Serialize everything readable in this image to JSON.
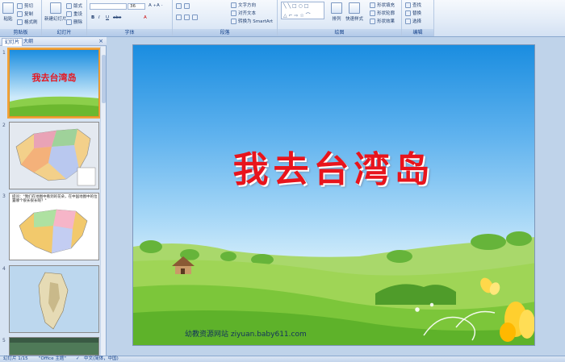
{
  "ribbon": {
    "clipboard": {
      "paste": "粘贴",
      "cut": "剪切",
      "copy": "复制",
      "format_painter": "格式刷",
      "label": "剪贴板"
    },
    "slides": {
      "new_slide": "新建幻灯片",
      "layout": "版式",
      "reset": "重设",
      "delete": "删除",
      "label": "幻灯片"
    },
    "font": {
      "font_size": "36",
      "label": "字体"
    },
    "paragraph": {
      "text_direction": "文字方向",
      "align_text": "对齐文本",
      "convert_smartart": "转换为 SmartArt",
      "label": "段落"
    },
    "drawing": {
      "arrange": "排列",
      "quick_styles": "快速样式",
      "shape_fill": "形状填充",
      "shape_outline": "形状轮廓",
      "shape_effects": "形状效果",
      "label": "绘图"
    },
    "editing": {
      "find": "查找",
      "replace": "替换",
      "select": "选择",
      "label": "编辑"
    }
  },
  "panel": {
    "tab_slides": "幻灯片",
    "tab_outline": "大纲",
    "close": "×",
    "thumbs": [
      {
        "num": "1",
        "title": "我去台湾岛"
      },
      {
        "num": "2"
      },
      {
        "num": "3",
        "text": "提问：\"我们在地图中看到的花朵，在中国地图中的位置哪个很长很长呢？\""
      },
      {
        "num": "4"
      },
      {
        "num": "5"
      }
    ]
  },
  "slide": {
    "title": "我去台湾岛",
    "footer": "幼教资源网站  ziyuan.baby611.com"
  },
  "status": {
    "slide_counter": "幻灯片 1/15",
    "theme": "\"Office 主题\"",
    "language": "中文(简体，中国)"
  },
  "colors": {
    "title": "#e8141c",
    "sky_top": "#1a8de0",
    "grass": "#7cc63a",
    "selection": "#f2a33a"
  }
}
